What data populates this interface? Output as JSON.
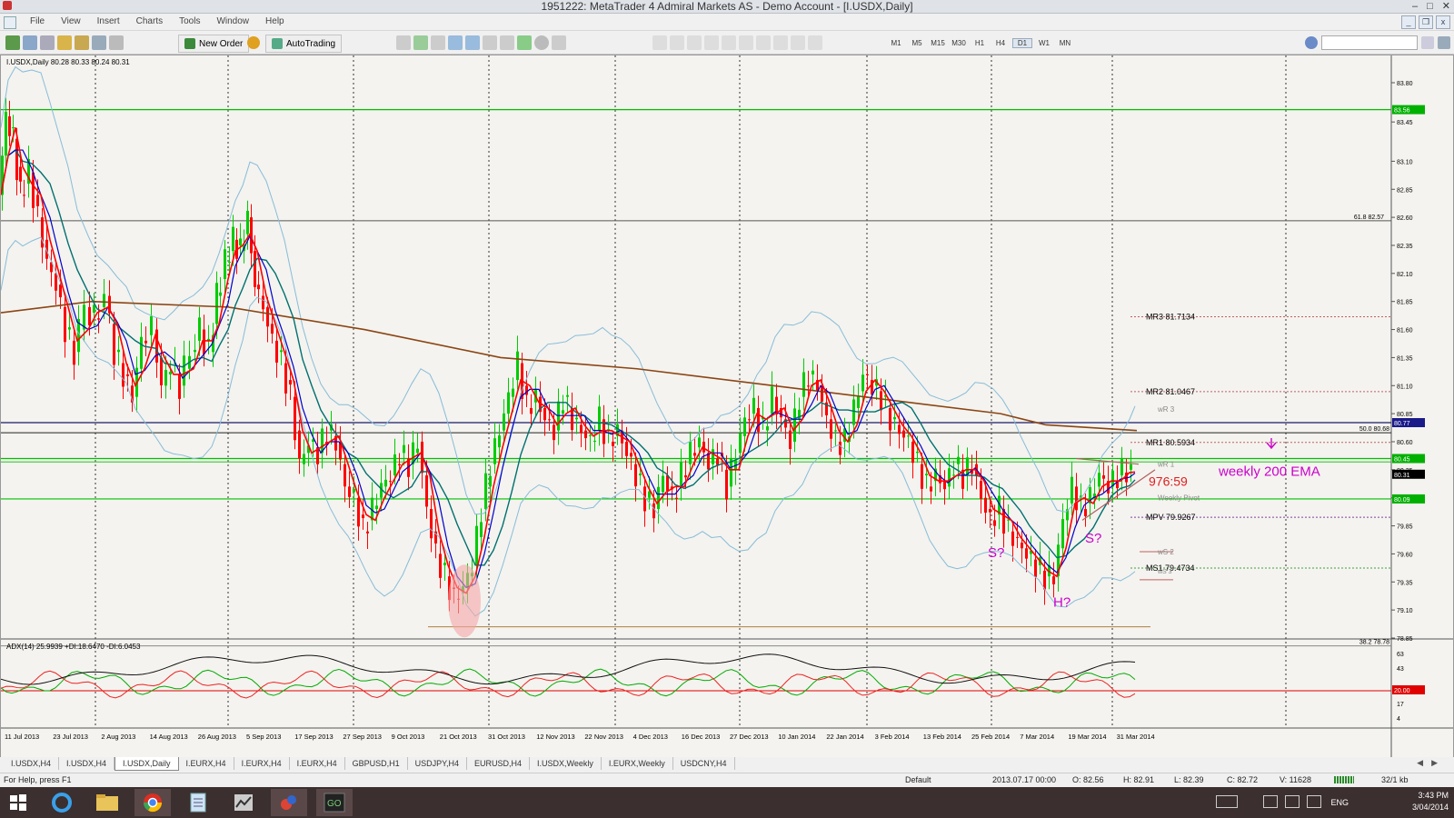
{
  "window": {
    "title": "1951222: MetaTrader 4 Admiral Markets AS - Demo Account - [I.USDX,Daily]"
  },
  "menu": [
    "File",
    "View",
    "Insert",
    "Charts",
    "Tools",
    "Window",
    "Help"
  ],
  "toolbar": {
    "new_order_label": "New Order",
    "autotrading_label": "AutoTrading",
    "timeframes": [
      "M1",
      "M5",
      "M15",
      "M30",
      "H1",
      "H4",
      "D1",
      "W1",
      "MN"
    ],
    "active_timeframe": "D1"
  },
  "chart": {
    "header": "I.USDX,Daily  80.28 80.33 80.24 80.31",
    "indicator_header": "ADX(14) 25.9939 +DI:18.6470 -DI:6.0453",
    "price_ticks": [
      "83.80",
      "83.45",
      "83.10",
      "82.85",
      "82.60",
      "82.35",
      "82.10",
      "81.85",
      "81.60",
      "81.35",
      "81.10",
      "80.85",
      "80.60",
      "80.35",
      "80.10",
      "79.85",
      "79.60",
      "79.35",
      "79.10",
      "78.85"
    ],
    "indicator_ticks": [
      "63",
      "43",
      "23",
      "17",
      "4"
    ],
    "right_price_tags": {
      "top_green": "83.56",
      "blue_line": "80.77",
      "green_1": "80.45",
      "current": "80.31",
      "green_2": "80.09",
      "adx_level": "20.00"
    },
    "fib_labels": {
      "f618": "61.8  82.57",
      "f500": "50.0  80.68",
      "f382": "38.2  78.78"
    },
    "date_ticks": [
      "11 Jul 2013",
      "23 Jul 2013",
      "2 Aug 2013",
      "14 Aug 2013",
      "26 Aug 2013",
      "5 Sep 2013",
      "17 Sep 2013",
      "27 Sep 2013",
      "9 Oct 2013",
      "21 Oct 2013",
      "31 Oct 2013",
      "12 Nov 2013",
      "22 Nov 2013",
      "4 Dec 2013",
      "16 Dec 2013",
      "27 Dec 2013",
      "10 Jan 2014",
      "22 Jan 2014",
      "3 Feb 2014",
      "13 Feb 2014",
      "25 Feb 2014",
      "7 Mar 2014",
      "19 Mar 2014",
      "31 Mar 2014"
    ],
    "pivots": {
      "mr3": "MR3  81.7134",
      "mr2": "MR2  81.0467",
      "wr3": "wR 3",
      "mr1": "MR1  80.5934",
      "wr1": "wR 1",
      "weekly_pivot": "Weekly Pivot",
      "mpv": "MPV  79.9267",
      "ws2": "wS 2",
      "ms1": "MS1  79.4734",
      "ws3": "wS 3"
    },
    "annotations": {
      "countdown": "976:59",
      "ema_label": "weekly 200 EMA",
      "s_left": "S?",
      "s_right": "S?",
      "head": "H?"
    },
    "colors": {
      "bull": "#00cc00",
      "bear": "#ff0000",
      "ema_fast": "#ff0000",
      "ema_mid": "#0000cc",
      "ema_slow": "#007070",
      "ema_long": "#8b4513",
      "bollinger": "#87bcd8",
      "annotation": "#cc00cc"
    }
  },
  "tabs": [
    "I.USDX,H4",
    "I.USDX,H4",
    "I.USDX,Daily",
    "I.EURX,H4",
    "I.EURX,H4",
    "I.EURX,H4",
    "GBPUSD,H1",
    "USDJPY,H4",
    "EURUSD,H4",
    "I.USDX,Weekly",
    "I.EURX,Weekly",
    "USDCNY,H4"
  ],
  "active_tab": "I.USDX,Daily",
  "status": {
    "help": "For Help, press F1",
    "profile": "Default",
    "datetime": "2013.07.17 00:00",
    "open": "O: 82.56",
    "high": "H: 82.91",
    "low": "L: 82.39",
    "close": "C: 82.72",
    "volume": "V: 11628",
    "traffic": "32/1 kb"
  },
  "tray": {
    "language": "ENG",
    "time": "3:43 PM",
    "date": "3/04/2014"
  }
}
